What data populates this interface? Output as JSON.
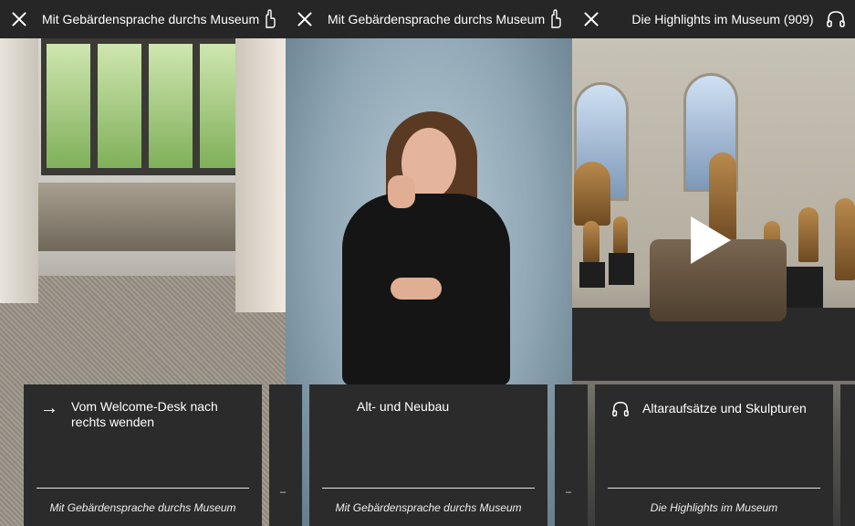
{
  "panels": [
    {
      "title": "Mit Gebärdensprache durchs Museum",
      "title_icon": "sign-language-hand-icon",
      "card": {
        "title": "Vom Welcome-Desk nach rechts wenden",
        "subtitle": "Mit Gebärdensprache durchs Museum",
        "icon": "arrow-right-icon"
      }
    },
    {
      "title": "Mit Gebärdensprache durchs Museum",
      "title_icon": "sign-language-hand-icon",
      "card": {
        "title": "Alt- und Neubau",
        "subtitle": "Mit Gebärdensprache durchs Museum"
      }
    },
    {
      "title": "Die Highlights im Museum (909)",
      "title_icon": "headphones-icon",
      "card": {
        "title": "Altaraufsätze und Skulpturen",
        "subtitle": "Die Highlights im Museum",
        "icon": "headphones-icon"
      }
    }
  ],
  "mini_cards": [
    {
      "mark": "–"
    },
    {
      "mark": "–"
    }
  ],
  "colors": {
    "bar": "#262626",
    "card": "#2b2b2b",
    "text": "#ffffff"
  }
}
